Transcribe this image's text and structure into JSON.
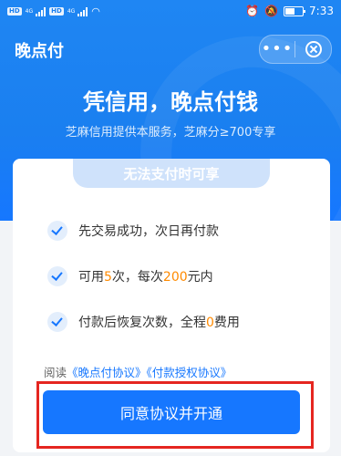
{
  "status_bar": {
    "time": "7:33",
    "hd1": "HD",
    "hd2": "HD",
    "net1": "4G",
    "net2": "4G"
  },
  "header": {
    "title": "晚点付",
    "more_label": "•••"
  },
  "hero": {
    "headline": "凭信用，晚点付钱",
    "subline": "芝麻信用提供本服务，芝麻分≥700专享"
  },
  "card": {
    "pill_label": "无法支付时可享",
    "features": [
      {
        "text": "先交易成功，次日再付款"
      },
      {
        "pre": "可用",
        "num1": "5",
        "mid": "次，每次",
        "num2": "200",
        "post": "元内"
      },
      {
        "pre": "付款后恢复次数，全程",
        "num": "0",
        "post": "费用"
      }
    ],
    "agreement": {
      "prefix": "阅读",
      "link1": "《晚点付协议》",
      "link2": "《付款授权协议》"
    },
    "cta_label": "同意协议并开通"
  },
  "colors": {
    "brand": "#1677ff",
    "highlight": "#ff8a00",
    "annotation": "#e52620"
  }
}
